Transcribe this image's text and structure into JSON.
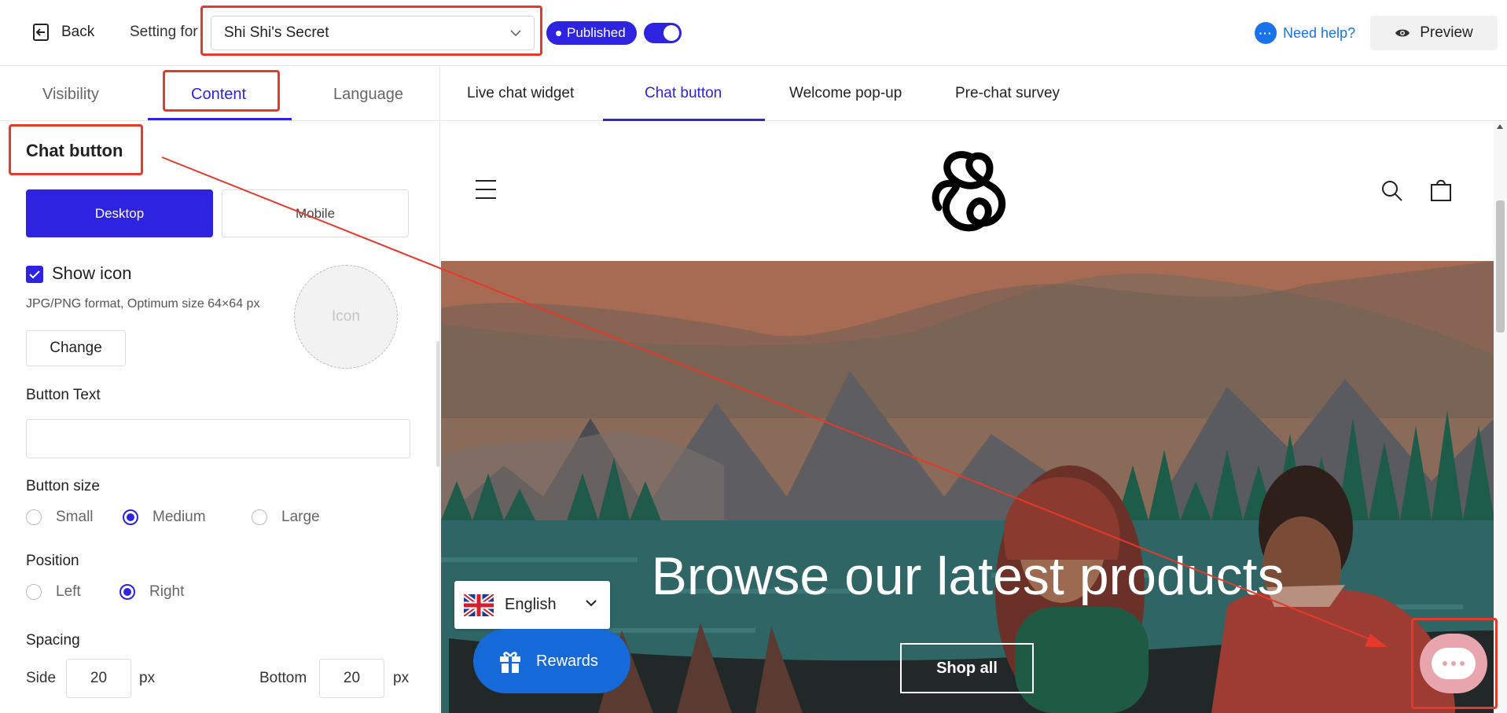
{
  "topbar": {
    "back_label": "Back",
    "setting_for_label": "Setting for",
    "store_select_value": "Shi Shi's Secret",
    "status_badge": "Published",
    "help_label": "Need help?",
    "preview_label": "Preview"
  },
  "left_tabs": [
    "Visibility",
    "Content",
    "Language"
  ],
  "right_tabs": [
    "Live chat widget",
    "Chat button",
    "Welcome pop-up",
    "Pre-chat survey"
  ],
  "settings": {
    "section_title": "Chat button",
    "device_desktop": "Desktop",
    "device_mobile": "Mobile",
    "show_icon_label": "Show icon",
    "format_hint": "JPG/PNG format, Optimum size 64×64 px",
    "change_label": "Change",
    "icon_placeholder": "Icon",
    "button_text_label": "Button Text",
    "button_text_value": "",
    "button_size_label": "Button size",
    "size_options": [
      "Small",
      "Medium",
      "Large"
    ],
    "size_selected": "Medium",
    "position_label": "Position",
    "position_options": [
      "Left",
      "Right"
    ],
    "position_selected": "Right",
    "spacing_label": "Spacing",
    "side_label": "Side",
    "side_value": "20",
    "bottom_label": "Bottom",
    "bottom_value": "20",
    "unit": "px"
  },
  "preview": {
    "hero_title": "Browse our latest products",
    "shop_all": "Shop all",
    "language": "English",
    "rewards": "Rewards"
  },
  "colors": {
    "accent": "#2d23e0",
    "annotation": "#e5392b",
    "chat_bubble": "#e8a5ad",
    "rewards": "#1669d9"
  }
}
